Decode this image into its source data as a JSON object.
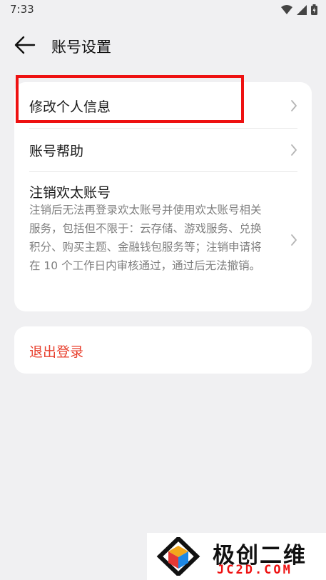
{
  "status_bar": {
    "time": "7:33"
  },
  "header": {
    "title": "账号设置"
  },
  "menu": {
    "edit_profile": "修改个人信息",
    "help": "账号帮助",
    "delete_account": {
      "title": "注销欢太账号",
      "description": "注销后无法再登录欢太账号并使用欢太账号相关服务，包括但不限于：云存储、游戏服务、兑换积分、购买主题、金融钱包服务等；注销申请将在 10 个工作日内审核通过，通过后无法撤销。"
    }
  },
  "logout": {
    "label": "退出登录",
    "color": "#e8412f"
  },
  "watermark": {
    "text": "极创二维",
    "sub": "JC2D.COM"
  },
  "colors": {
    "background": "#f0f0f2",
    "highlight": "#ee1111"
  }
}
